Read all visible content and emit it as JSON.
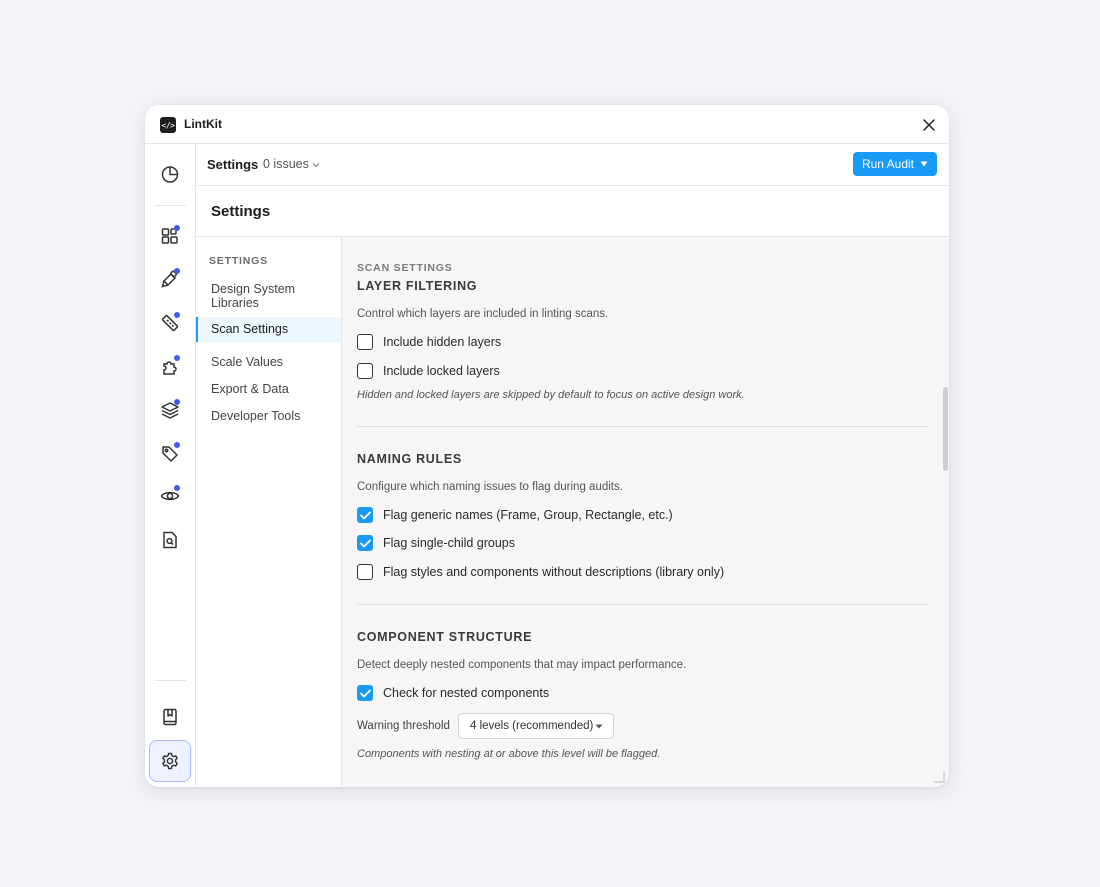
{
  "app": {
    "title": "LintKit",
    "logo_glyph": "</>"
  },
  "header": {
    "title": "Settings",
    "issues": "0 issues",
    "run_button": "Run Audit"
  },
  "page": {
    "title": "Settings"
  },
  "rail": {
    "items": [
      {
        "icon": "pie-chart-icon",
        "dot": false
      },
      {
        "icon": "grid-icon",
        "dot": true
      },
      {
        "icon": "paint-icon",
        "dot": true
      },
      {
        "icon": "ruler-icon",
        "dot": true
      },
      {
        "icon": "puzzle-icon",
        "dot": true
      },
      {
        "icon": "layers-icon",
        "dot": true
      },
      {
        "icon": "tag-icon",
        "dot": true
      },
      {
        "icon": "eye-icon",
        "dot": true
      },
      {
        "icon": "file-search-icon",
        "dot": false
      },
      {
        "icon": "book-icon",
        "dot": false
      },
      {
        "icon": "gear-icon",
        "dot": false,
        "active": true
      }
    ],
    "dot_color": "#3f5ce8"
  },
  "subnav": {
    "heading": "SETTINGS",
    "items": [
      {
        "label": "Design System\nLibraries"
      },
      {
        "label": "Scan Settings",
        "active": true
      },
      {
        "label": "Scale Values"
      },
      {
        "label": "Export & Data"
      },
      {
        "label": "Developer Tools"
      }
    ]
  },
  "content": {
    "kicker": "SCAN SETTINGS",
    "layer_filtering": {
      "title": "LAYER FILTERING",
      "description": "Control which layers are included in linting scans.",
      "options": [
        {
          "label": "Include hidden layers",
          "checked": false
        },
        {
          "label": "Include locked layers",
          "checked": false
        }
      ],
      "note": "Hidden and locked layers are skipped by default to focus on active design work."
    },
    "naming_rules": {
      "title": "NAMING RULES",
      "description": "Configure which naming issues to flag during audits.",
      "options": [
        {
          "label": "Flag generic names (Frame, Group, Rectangle, etc.)",
          "checked": true
        },
        {
          "label": "Flag single-child groups",
          "checked": true
        },
        {
          "label": "Flag styles and components without descriptions (library only)",
          "checked": false
        }
      ]
    },
    "component_structure": {
      "title": "COMPONENT STRUCTURE",
      "description": "Detect deeply nested components that may impact performance.",
      "options": [
        {
          "label": "Check for nested components",
          "checked": true
        }
      ],
      "threshold_label": "Warning threshold",
      "threshold_value": "4 levels (recommended)",
      "note": "Components with nesting at or above this level will be flagged."
    }
  },
  "colors": {
    "accent": "#1a9af7",
    "background": "#f3f4f8"
  }
}
